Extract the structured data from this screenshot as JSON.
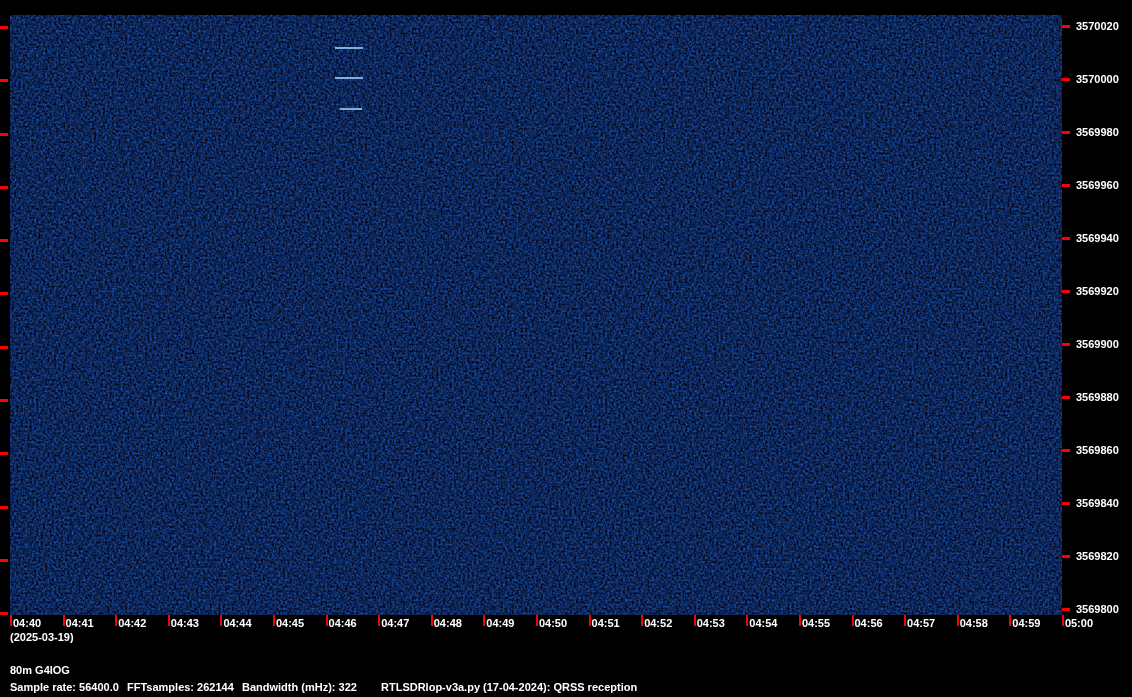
{
  "frequency_axis": [
    "3570020",
    "3570000",
    "3569980",
    "3569960",
    "3569940",
    "3569920",
    "3569900",
    "3569880",
    "3569860",
    "3569840",
    "3569820",
    "3569800"
  ],
  "time_axis": [
    "04:40",
    "04:41",
    "04:42",
    "04:43",
    "04:44",
    "04:45",
    "04:46",
    "04:47",
    "04:48",
    "04:49",
    "04:50",
    "04:51",
    "04:52",
    "04:53",
    "04:54",
    "04:55",
    "04:56",
    "04:57",
    "04:58",
    "04:59",
    "05:00"
  ],
  "date": "(2025-03-19)",
  "station": "80m G4IOG",
  "info": [
    "Sample rate: 56400.0",
    "FFTsamples: 262144",
    "Bandwidth (mHz): 322",
    "RTLSDRlop-v3a.py (17-04-2024): QRSS reception"
  ]
}
